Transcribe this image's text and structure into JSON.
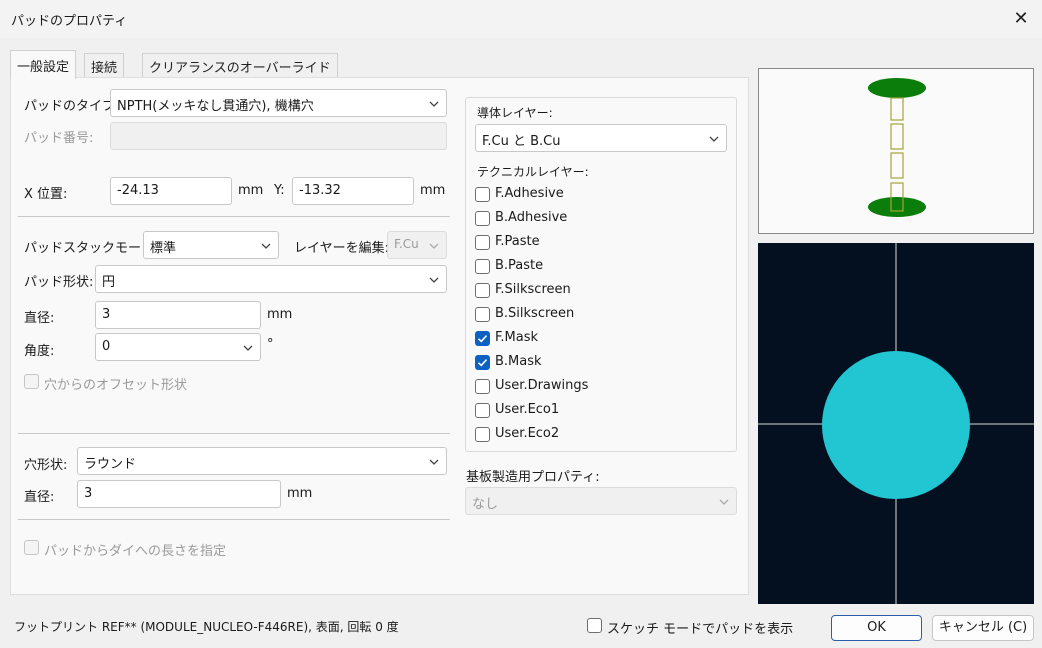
{
  "window": {
    "title": "パッドのプロパティ",
    "close_glyph": "✕"
  },
  "tabs": [
    {
      "label": "一般設定"
    },
    {
      "label": "接続"
    },
    {
      "label": "クリアランスのオーバーライド"
    }
  ],
  "general": {
    "pad_type_label": "パッドのタイプ:",
    "pad_type_value": "NPTH(メッキなし貫通穴), 機構穴",
    "pad_number_label": "パッド番号:",
    "x_label": "X 位置:",
    "x_value": "-24.13",
    "x_unit": "mm",
    "y_label": "Y:",
    "y_value": "-13.32",
    "y_unit": "mm",
    "stack_mode_label": "パッドスタックモード:",
    "stack_mode_value": "標準",
    "edit_layer_label": "レイヤーを編集:",
    "edit_layer_value": "F.Cu",
    "pad_shape_label": "パッド形状:",
    "pad_shape_value": "円",
    "diameter_label": "直径:",
    "diameter_value": "3",
    "diameter_unit": "mm",
    "angle_label": "角度:",
    "angle_value": "0",
    "angle_unit": "°",
    "offset_label": "穴からのオフセット形状",
    "hole_shape_label": "穴形状:",
    "hole_shape_value": "ラウンド",
    "hole_diameter_label": "直径:",
    "hole_diameter_value": "3",
    "hole_diameter_unit": "mm",
    "die_length_label": "パッドからダイへの長さを指定"
  },
  "layers": {
    "copper_label": "導体レイヤー:",
    "copper_value": "F.Cu と B.Cu",
    "tech_label": "テクニカルレイヤー:",
    "items": [
      {
        "label": "F.Adhesive",
        "checked": false
      },
      {
        "label": "B.Adhesive",
        "checked": false
      },
      {
        "label": "F.Paste",
        "checked": false
      },
      {
        "label": "B.Paste",
        "checked": false
      },
      {
        "label": "F.Silkscreen",
        "checked": false
      },
      {
        "label": "B.Silkscreen",
        "checked": false
      },
      {
        "label": "F.Mask",
        "checked": true
      },
      {
        "label": "B.Mask",
        "checked": true
      },
      {
        "label": "User.Drawings",
        "checked": false
      },
      {
        "label": "User.Eco1",
        "checked": false
      },
      {
        "label": "User.Eco2",
        "checked": false
      }
    ],
    "fab_label": "基板製造用プロパティ:",
    "fab_value": "なし"
  },
  "footer": {
    "info": "フットプリント REF** (MODULE_NUCLEO-F446RE), 表面, 回転 0 度",
    "sketch_label": "スケッチ モードでパッドを表示",
    "ok": "OK",
    "cancel": "キャンセル (C)"
  },
  "colors": {
    "preview_bg": "#04101f",
    "pad_fill": "#22c5d2",
    "cross_section_pad": "#0b7d0b",
    "cross_section_via": "#a4a43a",
    "checkbox_on": "#0e61c4"
  }
}
